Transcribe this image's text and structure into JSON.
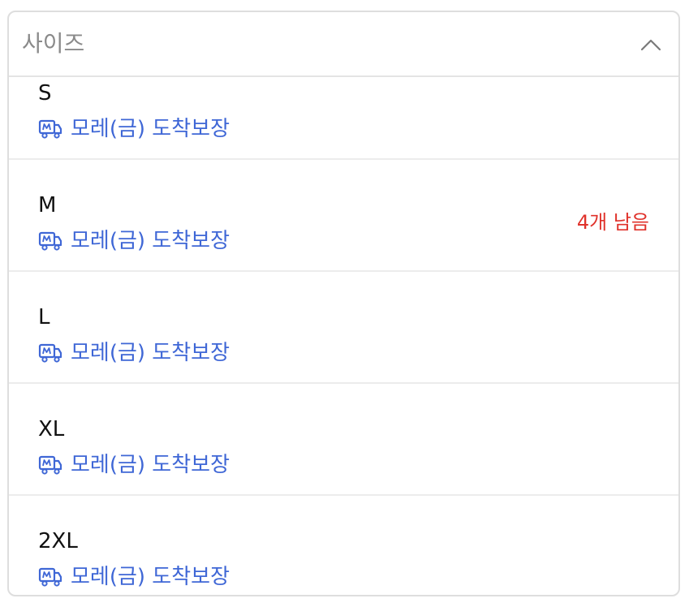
{
  "header": {
    "label": "사이즈"
  },
  "options": [
    {
      "size": "S",
      "shipping": "모레(금) 도착보장",
      "stock": ""
    },
    {
      "size": "M",
      "shipping": "모레(금) 도착보장",
      "stock": "4개 남음"
    },
    {
      "size": "L",
      "shipping": "모레(금) 도착보장",
      "stock": ""
    },
    {
      "size": "XL",
      "shipping": "모레(금) 도착보장",
      "stock": ""
    },
    {
      "size": "2XL",
      "shipping": "모레(금) 도착보장",
      "stock": ""
    }
  ],
  "icons": {
    "collapse": "chevron-up-icon",
    "shipping": "delivery-truck-icon"
  },
  "colors": {
    "shipping_text": "#3f67d6",
    "stock_text": "#e0322b",
    "header_text": "#8a8a8a"
  }
}
